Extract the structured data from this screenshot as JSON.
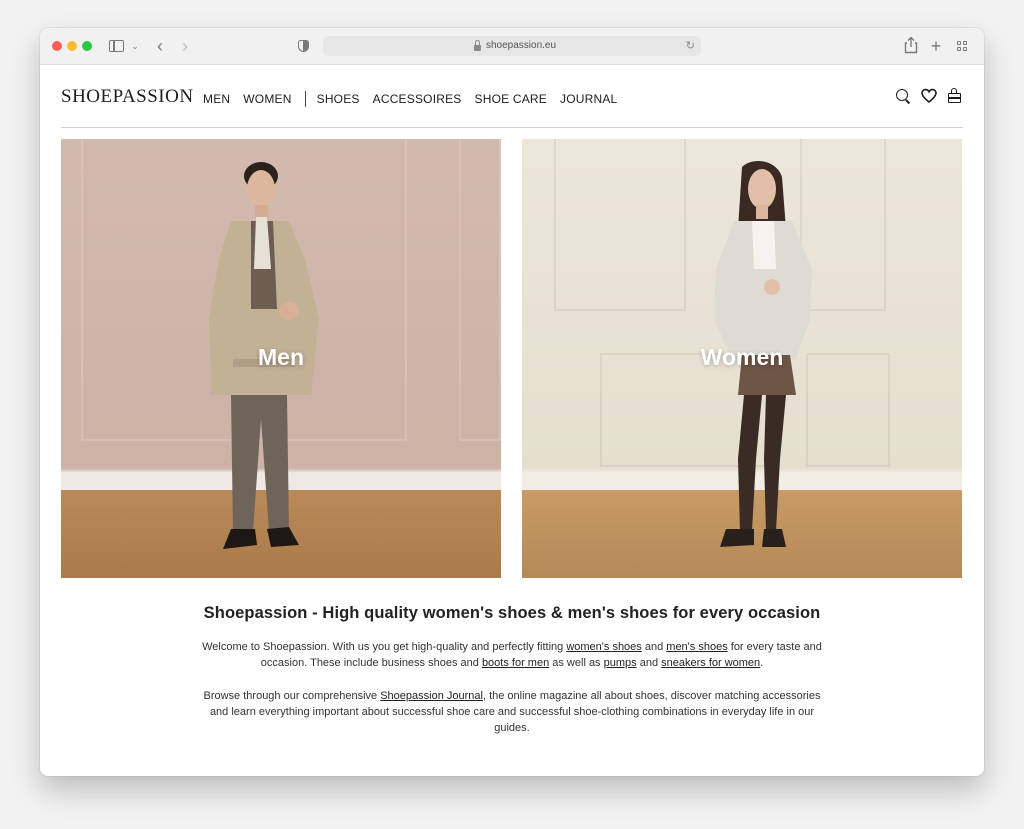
{
  "browser": {
    "url": "shoepassion.eu"
  },
  "header": {
    "logo": "SHOEPASSION",
    "nav": [
      "MEN",
      "WOMEN",
      "SHOES",
      "ACCESSOIRES",
      "SHOE CARE",
      "JOURNAL"
    ]
  },
  "hero": {
    "men_label": "Men",
    "women_label": "Women"
  },
  "content": {
    "heading": "Shoepassion - High quality women's shoes & men's shoes for every occasion",
    "p1": {
      "t1": "Welcome to Shoepassion. With us you get high-quality and perfectly fitting ",
      "l1": "women's shoes",
      "t2": " and ",
      "l2": "men's shoes",
      "t3": " for every taste and occasion. These include business shoes and ",
      "l3": "boots for men",
      "t4": " as well as ",
      "l4": "pumps",
      "t5": " and ",
      "l5": "sneakers for women",
      "t6": "."
    },
    "p2": {
      "t1": "Browse through our comprehensive ",
      "l1": "Shoepassion Journal",
      "t2": ", the online magazine all about shoes, discover matching accessories and learn everything important about successful shoe care and successful shoe-clothing combinations in everyday life in our guides."
    }
  },
  "colors": {
    "men_background": "#d2b9ae",
    "women_background": "#ece6d9",
    "text": "#1d1d1d"
  }
}
